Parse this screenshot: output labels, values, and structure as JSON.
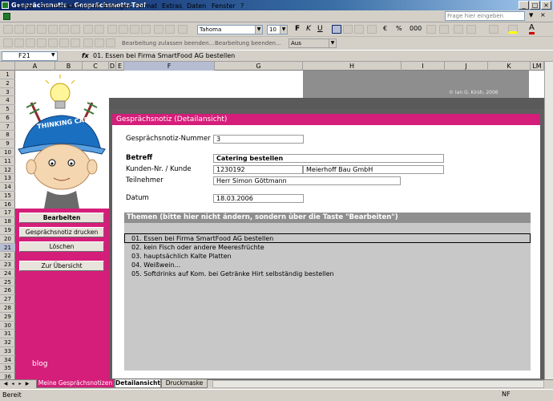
{
  "window": {
    "title": "Gesprächsnotiz - Gesprächsnotiz-Tool",
    "buttons": [
      "_",
      "□",
      "×"
    ]
  },
  "menu": {
    "items": [
      "Datei",
      "Bearbeiten",
      "Ansicht",
      "Einfügen",
      "Format",
      "Extras",
      "Daten",
      "Fenster",
      "?"
    ],
    "help_placeholder": "Frage hier eingeben"
  },
  "toolbar": {
    "font": "Tahoma",
    "size": "10",
    "protection_text1": "Bearbeitung zulassen beenden...",
    "protection_text2": "Bearbeitung beenden...",
    "zoom": "Aus"
  },
  "formula_bar": {
    "cell_ref": "F21",
    "fx": "fx",
    "content": "01. Essen bei Firma SmartFood AG bestellen"
  },
  "columns": [
    "A",
    "B",
    "C",
    "D",
    "E",
    "F",
    "G",
    "H",
    "I",
    "J",
    "K",
    "LM"
  ],
  "rows": [
    "1",
    "2",
    "3",
    "4",
    "5",
    "6",
    "7",
    "8",
    "9",
    "10",
    "11",
    "12",
    "13",
    "14",
    "15",
    "16",
    "17",
    "18",
    "19",
    "20",
    "21",
    "22",
    "23",
    "24",
    "25",
    "26",
    "27",
    "28",
    "29",
    "30",
    "31",
    "32",
    "33",
    "34",
    "35",
    "36"
  ],
  "illustration": {
    "cap_text": "THINKING CAP"
  },
  "sidebar": {
    "buttons": [
      "Bearbeiten",
      "Gesprächsnotiz drucken",
      "Löschen",
      "Zur Übersicht"
    ],
    "blog": "blog"
  },
  "copyright": "© Ian G. Kirsh, 2006",
  "detail": {
    "header": "Gesprächsnotiz (Detailansicht)",
    "number_label": "Gesprächsnotiz-Nummer",
    "number_value": "3",
    "subject_label": "Betreff",
    "subject_value": "Catering bestellen",
    "customer_label": "Kunden-Nr. / Kunde",
    "customer_no": "1230192",
    "customer_name": "Meierhoff Bau GmbH",
    "participant_label": "Teilnehmer",
    "participant_value": "Herr Simon Göttmann",
    "date_label": "Datum",
    "date_value": "18.03.2006"
  },
  "themes": {
    "header": "Themen (bitte hier nicht ändern, sondern über die Taste \"Bearbeiten\")",
    "items": [
      "01. Essen bei Firma SmartFood AG bestellen",
      "02. kein Fisch oder andere Meeresfrüchte",
      "03. hauptsächlich Kalte Platten",
      "04. Weißwein...",
      "05. Softdrinks auf Kom. bei Getränke Hirt selbständig bestellen"
    ]
  },
  "sheet_tabs": [
    "Meine Gesprächsnotizen",
    "Detailansicht",
    "Druckmaske"
  ],
  "status": {
    "left": "Bereit",
    "right": "NF"
  },
  "colors": {
    "accent": "#d51e7a",
    "title_bar": "#0a246a"
  }
}
